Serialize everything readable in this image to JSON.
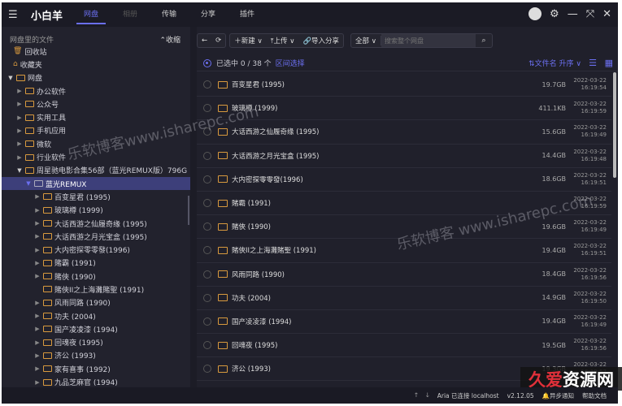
{
  "titlebar": {
    "app_title": "小白羊",
    "tabs": [
      {
        "label": "网盘",
        "active": true
      },
      {
        "label": "相册",
        "active": false
      },
      {
        "label": "传输",
        "active": false
      },
      {
        "label": "分享",
        "active": false
      },
      {
        "label": "插件",
        "active": false
      }
    ]
  },
  "sidebar": {
    "heading": "网盘里的文件",
    "collapse_label": "收缩",
    "items": [
      {
        "label": "回收站",
        "level": 0,
        "icon": "trash-icon"
      },
      {
        "label": "收藏夹",
        "level": 0,
        "icon": "favorites-icon"
      },
      {
        "label": "网盘",
        "level": 0,
        "expanded": true
      },
      {
        "label": "办公软件",
        "level": 1
      },
      {
        "label": "公众号",
        "level": 1
      },
      {
        "label": "实用工具",
        "level": 1
      },
      {
        "label": "手机应用",
        "level": 1
      },
      {
        "label": "微软",
        "level": 1
      },
      {
        "label": "行业软件",
        "level": 1
      },
      {
        "label": "周星驰电影合集56部（蓝光REMUX版）796G",
        "level": 1,
        "expanded": true
      },
      {
        "label": "蓝光REMUX",
        "level": 2,
        "expanded": true,
        "selected": true
      },
      {
        "label": "百变星君 (1995)",
        "level": 3
      },
      {
        "label": "玻璃樽 (1999)",
        "level": 3
      },
      {
        "label": "大话西游之仙履奇缘 (1995)",
        "level": 3
      },
      {
        "label": "大话西游之月光宝盒 (1995)",
        "level": 3
      },
      {
        "label": "大内密探零零發(1996)",
        "level": 3
      },
      {
        "label": "賭霸 (1991)",
        "level": 3
      },
      {
        "label": "賭俠 (1990)",
        "level": 3
      },
      {
        "label": "賭俠II之上海灘賭聖 (1991)",
        "level": 3,
        "leaf": true
      },
      {
        "label": "风雨同路 (1990)",
        "level": 3
      },
      {
        "label": "功夫 (2004)",
        "level": 3
      },
      {
        "label": "国产凌凌漆 (1994)",
        "level": 3
      },
      {
        "label": "回魂夜 (1995)",
        "level": 3
      },
      {
        "label": "济公 (1993)",
        "level": 3
      },
      {
        "label": "家有喜事 (1992)",
        "level": 3
      },
      {
        "label": "九品芝麻官 (1994)",
        "level": 3
      }
    ]
  },
  "toolbar": {
    "new_label": "新建",
    "upload_label": "上传",
    "import_label": "导入分享",
    "scope_label": "全部",
    "search_placeholder": "搜索整个网盘"
  },
  "status": {
    "selected_text": "已选中 0 / 38 个",
    "range_select": "区间选择",
    "sort_label": "文件名 升序"
  },
  "files": [
    {
      "name": "百变星君 (1995)",
      "size": "19.7GB",
      "date": "2022-03-22",
      "time": "16:19:54"
    },
    {
      "name": "玻璃樽 (1999)",
      "size": "411.1KB",
      "date": "2022-03-22",
      "time": "16:19:59"
    },
    {
      "name": "大话西游之仙履奇缘 (1995)",
      "size": "15.6GB",
      "date": "2022-03-22",
      "time": "16:19:49"
    },
    {
      "name": "大话西游之月光宝盒 (1995)",
      "size": "14.4GB",
      "date": "2022-03-22",
      "time": "16:19:48"
    },
    {
      "name": "大内密探零零發(1996)",
      "size": "18.6GB",
      "date": "2022-03-22",
      "time": "16:19:51"
    },
    {
      "name": "賭霸 (1991)",
      "size": "",
      "date": "2022-03-22",
      "time": "16:19:59"
    },
    {
      "name": "賭俠 (1990)",
      "size": "19.6GB",
      "date": "2022-03-22",
      "time": "16:19:49"
    },
    {
      "name": "賭俠II之上海灘賭聖 (1991)",
      "size": "19.4GB",
      "date": "2022-03-22",
      "time": "16:19:51"
    },
    {
      "name": "风雨同路 (1990)",
      "size": "18.4GB",
      "date": "2022-03-22",
      "time": "16:19:56"
    },
    {
      "name": "功夫 (2004)",
      "size": "14.9GB",
      "date": "2022-03-22",
      "time": "16:19:50"
    },
    {
      "name": "国产凌凌漆 (1994)",
      "size": "19.4GB",
      "date": "2022-03-22",
      "time": "16:19:49"
    },
    {
      "name": "回魂夜 (1995)",
      "size": "19.5GB",
      "date": "2022-03-22",
      "time": "16:19:56"
    },
    {
      "name": "济公 (1993)",
      "size": "19.3GB",
      "date": "2022-03-22",
      "time": "16:19:57"
    },
    {
      "name": "家有喜事 (1992)",
      "size": "",
      "date": "",
      "time": ""
    }
  ],
  "statusbar": {
    "aria": "Aria 已连接 localhost",
    "version": "v2.12.05",
    "notify": "异步通知",
    "help": "帮助文档"
  },
  "watermarks": {
    "text1": "乐软博客www.isharepc.com",
    "text2": "乐软博客 www.isharepc.com",
    "badge_red": "久爱",
    "badge_white": "资源网"
  },
  "colors": {
    "accent": "#6b6ff0",
    "folder": "#d99a3e",
    "background": "#20202b"
  }
}
